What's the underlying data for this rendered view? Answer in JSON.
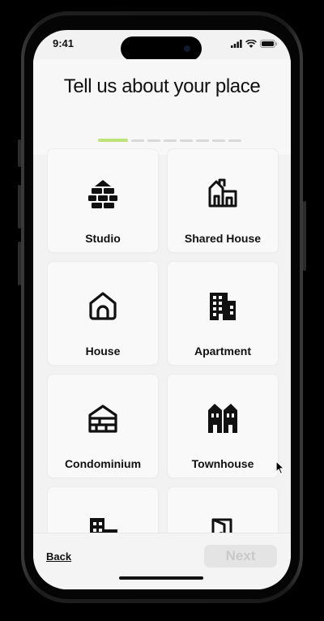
{
  "status_bar": {
    "time": "9:41"
  },
  "header": {
    "title": "Tell us about your place",
    "steps_total": 8,
    "current_step": 1
  },
  "accent_color": "#bde37a",
  "property_types": [
    {
      "label": "Studio",
      "icon": "bricks-icon"
    },
    {
      "label": "Shared House",
      "icon": "shared-house-icon"
    },
    {
      "label": "House",
      "icon": "house-icon"
    },
    {
      "label": "Apartment",
      "icon": "apartment-building-icon"
    },
    {
      "label": "Condominium",
      "icon": "condominium-icon"
    },
    {
      "label": "Townhouse",
      "icon": "townhouse-icon"
    },
    {
      "label": "",
      "icon": "office-building-icon"
    },
    {
      "label": "",
      "icon": "door-icon"
    }
  ],
  "footer": {
    "back_label": "Back",
    "next_label": "Next"
  }
}
